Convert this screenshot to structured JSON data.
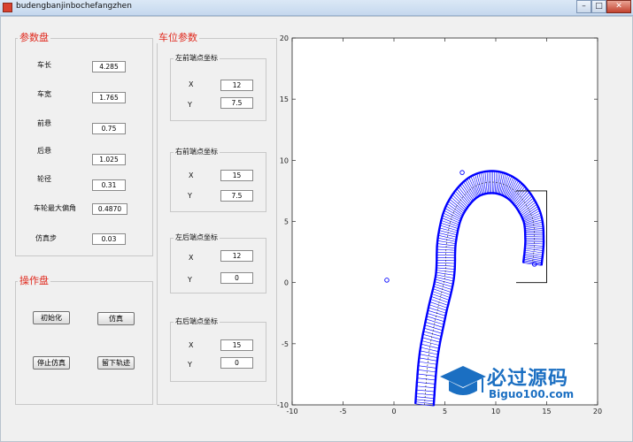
{
  "window": {
    "title": "budengbanjinbochefangzhen",
    "min_glyph": "–",
    "max_glyph": "□",
    "close_glyph": "✕",
    "icon": "matlab-figure-icon"
  },
  "params_panel": {
    "title": "参数盘",
    "fields": [
      {
        "label": "车长",
        "value": "4.285"
      },
      {
        "label": "车宽",
        "value": "1.765"
      },
      {
        "label": "前悬",
        "value": "0.75"
      },
      {
        "label": "后悬",
        "value": "1.025"
      },
      {
        "label": "轮径",
        "value": "0.31"
      },
      {
        "label": "车轮最大偏角",
        "value": "0.4870"
      },
      {
        "label": "仿真步",
        "value": "0.03"
      }
    ]
  },
  "ops_panel": {
    "title": "操作盘",
    "buttons": {
      "init": "初始化",
      "simulate": "仿真",
      "stop": "停止仿真",
      "trace": "留下轨迹"
    }
  },
  "slot_panel": {
    "title": "车位参数",
    "groups": [
      {
        "title": "左前端点坐标",
        "x_label": "X",
        "y_label": "Y",
        "x": "12",
        "y": "7.5"
      },
      {
        "title": "右前端点坐标",
        "x_label": "X",
        "y_label": "Y",
        "x": "15",
        "y": "7.5"
      },
      {
        "title": "左后端点坐标",
        "x_label": "X",
        "y_label": "Y",
        "x": "12",
        "y": "0"
      },
      {
        "title": "右后端点坐标",
        "x_label": "X",
        "y_label": "Y",
        "x": "15",
        "y": "0"
      }
    ]
  },
  "chart_data": {
    "type": "line",
    "xlim": [
      -10,
      20
    ],
    "ylim": [
      -10,
      20
    ],
    "x_ticks": [
      -10,
      -5,
      0,
      5,
      10,
      15,
      20
    ],
    "y_ticks": [
      -10,
      -5,
      0,
      5,
      10,
      15,
      20
    ],
    "grid": false,
    "series_color": "#0000ff",
    "slot_outline": [
      [
        12,
        7.5
      ],
      [
        15,
        7.5
      ],
      [
        15,
        0
      ],
      [
        12,
        0
      ]
    ],
    "path_center": [
      [
        3.0,
        -10.0
      ],
      [
        3.4,
        -6.0
      ],
      [
        4.2,
        -2.5
      ],
      [
        5.0,
        0.5
      ],
      [
        5.2,
        3.5
      ],
      [
        6.0,
        6.0
      ],
      [
        7.8,
        7.8
      ],
      [
        10.0,
        8.2
      ],
      [
        12.0,
        7.4
      ],
      [
        13.5,
        5.5
      ],
      [
        13.8,
        3.5
      ],
      [
        13.6,
        1.5
      ]
    ],
    "markers": [
      {
        "x": -0.7,
        "y": 0.2
      },
      {
        "x": 6.7,
        "y": 9.0
      },
      {
        "x": 13.8,
        "y": 1.5
      }
    ]
  },
  "watermark": {
    "main": "必过源码",
    "sub": "Biguo100.com",
    "icon": "graduation-cap-icon"
  },
  "colors": {
    "accent": "#e0281c",
    "plot": "#0000ff",
    "watermark": "#1b6fc2"
  }
}
